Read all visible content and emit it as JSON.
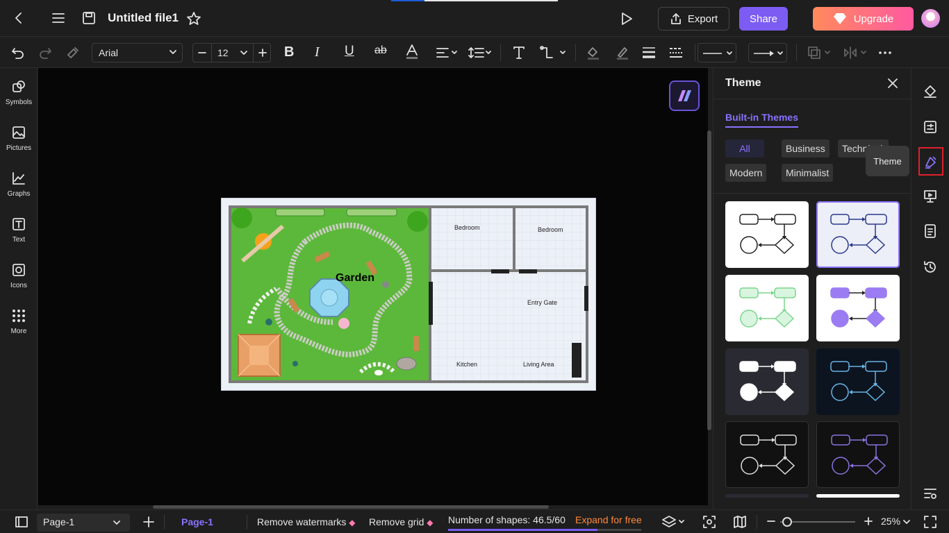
{
  "header": {
    "title": "Untitled file1",
    "export_label": "Export",
    "share_label": "Share",
    "upgrade_label": "Upgrade"
  },
  "toolbar": {
    "font_family": "Arial",
    "font_size": "12"
  },
  "left_sidebar": {
    "items": [
      {
        "label": "Symbols",
        "icon": "symbols-icon"
      },
      {
        "label": "Pictures",
        "icon": "pictures-icon"
      },
      {
        "label": "Graphs",
        "icon": "graphs-icon"
      },
      {
        "label": "Text",
        "icon": "text-icon"
      },
      {
        "label": "Icons",
        "icon": "icons-icon"
      },
      {
        "label": "More",
        "icon": "more-icon"
      }
    ]
  },
  "diagram": {
    "title": "Garden",
    "rooms": [
      "Bedroom",
      "Bedroom",
      "Entry Gate",
      "Kitchen",
      "Living Area"
    ]
  },
  "theme_panel": {
    "title": "Theme",
    "tab": "Built-in Themes",
    "filters": [
      "All",
      "Business",
      "Technical",
      "Modern",
      "Minimalist"
    ],
    "active_filter": "All",
    "selected_card": 2
  },
  "tooltip": {
    "text": "Theme"
  },
  "status": {
    "page_select": "Page-1",
    "page_tab": "Page-1",
    "remove_watermarks": "Remove watermarks",
    "remove_grid": "Remove grid",
    "shape_count": "Number of shapes: 46.5/60",
    "shape_fraction": 0.775,
    "expand": "Expand for free",
    "zoom": "25%"
  },
  "colors": {
    "accent": "#7c5cf2",
    "highlight": "#e0202c",
    "expand": "#ff8a3c"
  }
}
